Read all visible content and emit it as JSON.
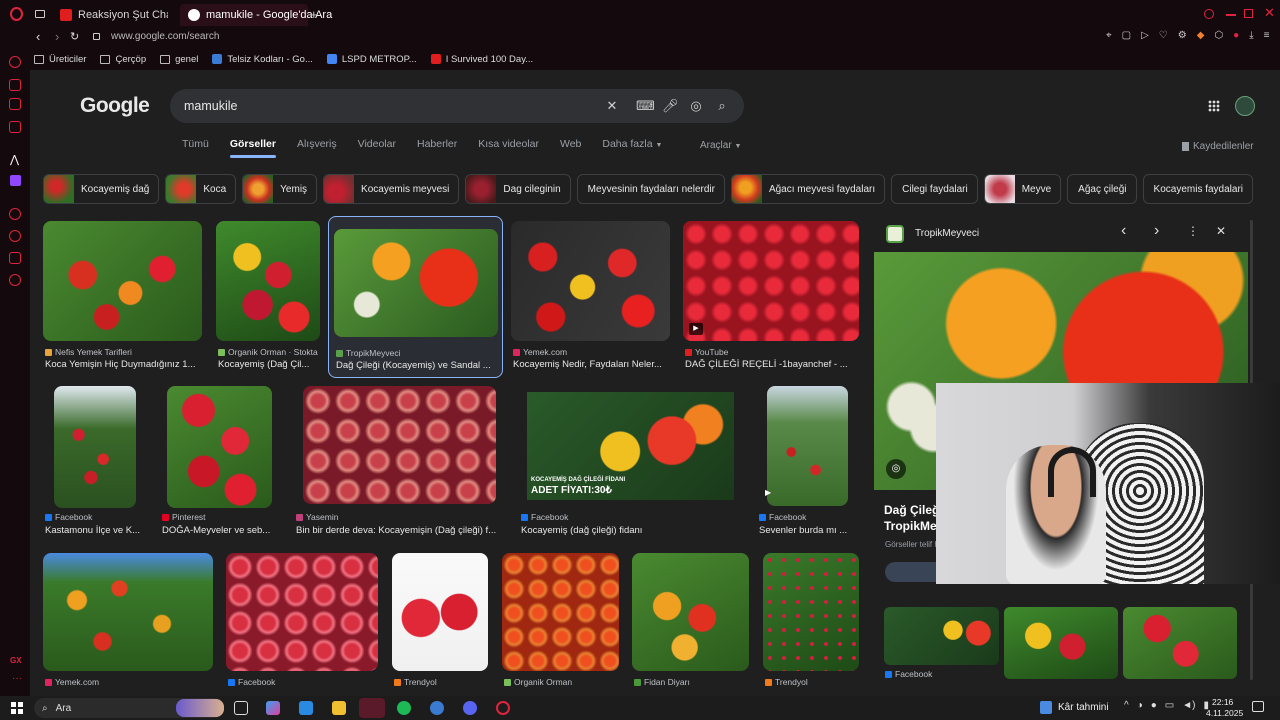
{
  "tabs": [
    {
      "title": "Reaksiyon Şut Challenge!",
      "color": "#e01e1e"
    },
    {
      "title": "mamukile - Google'da Ara",
      "color": "#ffffff"
    }
  ],
  "address": "www.google.com/search",
  "bookmarks": [
    "Üreticiler",
    "Çerçöp",
    "genel",
    "Telsiz Kodları - Go...",
    "LSPD METROP...",
    "I Survived 100 Day..."
  ],
  "google": {
    "logo": "Google",
    "query": "mamukile",
    "nav": [
      "Tümü",
      "Görseller",
      "Alışveriş",
      "Videolar",
      "Haberler",
      "Kısa videolar",
      "Web",
      "Daha fazla"
    ],
    "active_nav": "Görseller",
    "tools": "Araçlar",
    "saved": "Kaydedilenler"
  },
  "chips": [
    {
      "label": "Kocayemiş dağ",
      "img": true
    },
    {
      "label": "Koca",
      "img": true
    },
    {
      "label": "Yemiş",
      "img": true
    },
    {
      "label": "Kocayemis meyvesi",
      "img": true
    },
    {
      "label": "Dag cileginin",
      "img": true
    },
    {
      "label": "Meyvesinin faydaları nelerdir",
      "img": false
    },
    {
      "label": "Ağacı meyvesi faydaları",
      "img": true
    },
    {
      "label": "Cilegi faydalari",
      "img": false
    },
    {
      "label": "Meyve",
      "img": true
    },
    {
      "label": "Ağaç çileği",
      "img": false
    },
    {
      "label": "Kocayemis faydalari",
      "img": false
    }
  ],
  "results_row1": [
    {
      "source": "Nefis Yemek Tarifleri",
      "title": "Koca Yemişin Hiç Duymadığınız 1...",
      "src_color": "#e8a33a"
    },
    {
      "source": "Organik Orman · Stokta",
      "title": "Kocayemiş (Dağ Çil...",
      "src_color": "#7bbf5a"
    },
    {
      "source": "TropikMeyveci",
      "title": "Dağ Çileği (Kocayemiş) ve Sandal ...",
      "src_color": "#5aa04a"
    },
    {
      "source": "Yemek.com",
      "title": "Kocayemiş Nedir, Faydaları Neler...",
      "src_color": "#e0245e"
    },
    {
      "source": "YouTube",
      "title": "DAĞ ÇİLEĞİ REÇELİ -1bayanchef - ...",
      "src_color": "#e01e1e"
    }
  ],
  "results_row2": [
    {
      "source": "Facebook",
      "title": "Kastamonu İlçe ve K...",
      "src_color": "#1877f2"
    },
    {
      "source": "Pinterest",
      "title": "DOĞA-Meyveler ve seb...",
      "src_color": "#e60023"
    },
    {
      "source": "Yasemin",
      "title": "Bin bir derde deva: Kocayemişin (Dağ çileği) f...",
      "src_color": "#c0407a"
    },
    {
      "source": "Facebook",
      "title": "Kocayemiş (dağ çileği) fidanı",
      "src_color": "#1877f2"
    },
    {
      "source": "Facebook",
      "title": "Sevenler burda mı ...",
      "src_color": "#1877f2"
    }
  ],
  "results_row3": [
    {
      "source": "Yemek.com",
      "src_color": "#e0245e"
    },
    {
      "source": "Facebook",
      "src_color": "#1877f2"
    },
    {
      "source": "Trendyol",
      "src_color": "#f27a1a"
    },
    {
      "source": "Organik Orman",
      "src_color": "#7bbf5a"
    },
    {
      "source": "Fidan Diyarı",
      "src_color": "#4a9a3a"
    },
    {
      "source": "Trendyol",
      "src_color": "#f27a1a"
    }
  ],
  "ad_text": {
    "line1": "KOCAYEMİŞ DAĞ ÇİLEĞİ FİDANI",
    "line2": "ADET FİYATI:30₺"
  },
  "panel": {
    "source": "TropikMeyveci",
    "title_line1": "Dağ Çileğ",
    "title_line2": "TropikMeyv",
    "license": "Görseller telif h",
    "related_source": "Facebook"
  },
  "taskbar": {
    "search": "Ara",
    "weather": "Kâr tahmini",
    "time": "22:16",
    "date": "4.11.2025"
  }
}
